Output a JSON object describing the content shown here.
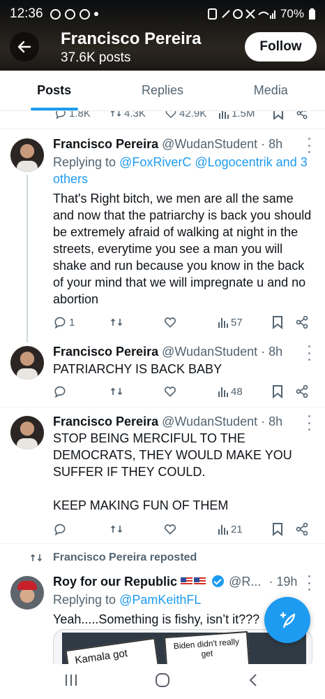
{
  "status_bar": {
    "time": "12:36",
    "battery": "70%"
  },
  "header": {
    "name": "Francisco Pereira",
    "post_count": "37.6K posts",
    "follow_label": "Follow"
  },
  "tabs": [
    {
      "label": "Posts",
      "active": true
    },
    {
      "label": "Replies",
      "active": false
    },
    {
      "label": "Media",
      "active": false
    }
  ],
  "previous_stats": {
    "replies": "1.8K",
    "reposts": "4.3K",
    "likes": "42.9K",
    "views": "1.5M"
  },
  "tweets": [
    {
      "name": "Francisco Pereira",
      "handle_time": "@WudanStudent · 8h",
      "reply_prefix": "Replying to ",
      "reply_links": "@FoxRiverC @Logocentrik and 3 others",
      "text": "That's Right bitch, we men are all the same and now that the patriarchy is back you should be extremely afraid of walking at night in the streets, everytime you see a man you will shake and run because you know in the back of your mind that we will impregnate u and no abortion",
      "replies": "1",
      "views": "57"
    },
    {
      "name": "Francisco Pereira",
      "handle_time": "@WudanStudent · 8h",
      "text": "PATRIARCHY IS BACK BABY",
      "views": "48"
    },
    {
      "name": "Francisco Pereira",
      "handle_time": "@WudanStudent · 8h",
      "text": "STOP BEING MERCIFUL TO THE DEMOCRATS, THEY WOULD MAKE YOU SUFFER IF THEY COULD.\n\nKEEP MAKING FUN OF THEM",
      "views": "21"
    }
  ],
  "repost": {
    "label": "Francisco Pereira reposted",
    "name": "Roy for our Republic",
    "handle": "@R...",
    "time": "· 19h",
    "reply_prefix": "Replying to ",
    "reply_link": "@PamKeithFL",
    "text": "Yeah.....Something is fishy, isn’t it???",
    "media_text_1": "Kamala got",
    "media_text_2": "Biden didn't really get"
  },
  "colors": {
    "accent": "#1d9bf0",
    "text": "#0f1419",
    "muted": "#536471"
  }
}
